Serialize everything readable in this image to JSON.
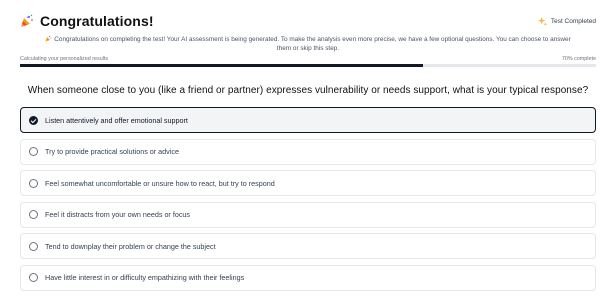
{
  "header": {
    "title": "Congratulations!",
    "status": "Test Completed"
  },
  "message": {
    "line1": "Congratulations on completing the test! Your AI assessment is being generated. To make the analysis even more precise, we have a few optional questions. You can choose to answer",
    "line2": "them or skip this step."
  },
  "progress": {
    "label": "Calculating your personalized results",
    "percent_label": "70% complete",
    "value": 0.7
  },
  "question": "When someone close to you (like a friend or partner) expresses vulnerability or needs support, what is your typical response?",
  "options": [
    {
      "label": "Listen attentively and offer emotional support",
      "selected": true
    },
    {
      "label": "Try to provide practical solutions or advice",
      "selected": false
    },
    {
      "label": "Feel somewhat uncomfortable or unsure how to react, but try to respond",
      "selected": false
    },
    {
      "label": "Feel it distracts from your own needs or focus",
      "selected": false
    },
    {
      "label": "Tend to downplay their problem or change the subject",
      "selected": false
    },
    {
      "label": "Have little interest in or difficulty empathizing with their feelings",
      "selected": false
    }
  ],
  "icons": {
    "title_icon": "party-popper-icon",
    "status_icon": "sparkle-icon"
  },
  "colors": {
    "accent": "#111827",
    "status_icon": "#f5b342"
  }
}
